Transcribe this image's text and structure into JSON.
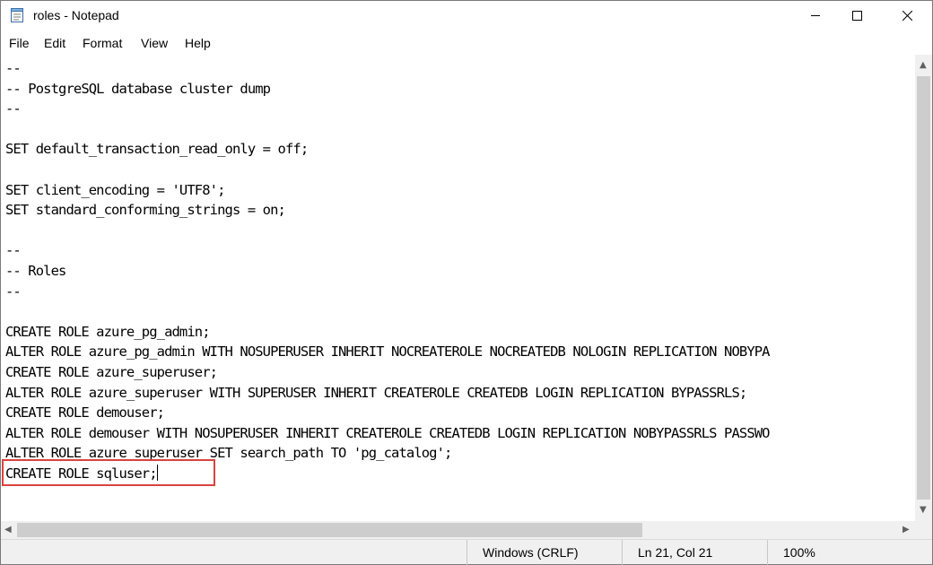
{
  "window": {
    "title": "roles - Notepad"
  },
  "menu": [
    "File",
    "Edit",
    "Format",
    "View",
    "Help"
  ],
  "editor": {
    "lines": [
      "--",
      "-- PostgreSQL database cluster dump",
      "--",
      "",
      "SET default_transaction_read_only = off;",
      "",
      "SET client_encoding = 'UTF8';",
      "SET standard_conforming_strings = on;",
      "",
      "--",
      "-- Roles",
      "--",
      "",
      "CREATE ROLE azure_pg_admin;",
      "ALTER ROLE azure_pg_admin WITH NOSUPERUSER INHERIT NOCREATEROLE NOCREATEDB NOLOGIN REPLICATION NOBYPA",
      "CREATE ROLE azure_superuser;",
      "ALTER ROLE azure_superuser WITH SUPERUSER INHERIT CREATEROLE CREATEDB LOGIN REPLICATION BYPASSRLS;",
      "CREATE ROLE demouser;",
      "ALTER ROLE demouser WITH NOSUPERUSER INHERIT CREATEROLE CREATEDB LOGIN REPLICATION NOBYPASSRLS PASSWO",
      "ALTER ROLE azure_superuser SET search_path TO 'pg_catalog';",
      "CREATE ROLE sqluser;"
    ]
  },
  "status": {
    "line_ending": "Windows (CRLF)",
    "position": "Ln 21, Col 21",
    "zoom": "100%"
  },
  "colors": {
    "highlight": "#d9433f"
  }
}
